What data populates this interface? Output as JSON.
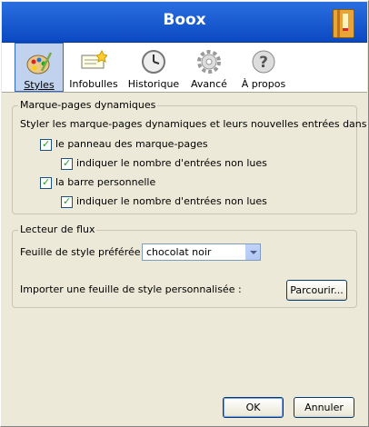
{
  "window": {
    "title": "Boox"
  },
  "tabs": [
    {
      "label": "Styles",
      "icon": "palette-icon",
      "selected": true
    },
    {
      "label": "Infobulles",
      "icon": "tooltip-icon",
      "selected": false
    },
    {
      "label": "Historique",
      "icon": "clock-icon",
      "selected": false
    },
    {
      "label": "Avancé",
      "icon": "gear-icon",
      "selected": false
    },
    {
      "label": "À propos",
      "icon": "question-icon",
      "selected": false
    }
  ],
  "dynamic": {
    "legend": "Marque-pages dynamiques",
    "intro": "Styler les marque-pages dynamiques et leurs nouvelles entrées dans :",
    "panel_label": "le panneau des marque-pages",
    "panel_checked": true,
    "panel_count_label": "indiquer le nombre d'entrées non lues",
    "panel_count_checked": true,
    "toolbar_label": "la barre personnelle",
    "toolbar_checked": true,
    "toolbar_count_label": "indiquer le nombre d'entrées non lues",
    "toolbar_count_checked": true
  },
  "feed": {
    "legend": "Lecteur de flux",
    "style_label": "Feuille de style préférée :",
    "style_value": "chocolat noir",
    "import_label": "Importer une feuille de style personnalisée :",
    "browse_label": "Parcourir..."
  },
  "buttons": {
    "ok": "OK",
    "cancel": "Annuler"
  },
  "colors": {
    "titlebar": "#1658d6",
    "check": "#21a121",
    "selected_tab": "#c1d2ee"
  }
}
